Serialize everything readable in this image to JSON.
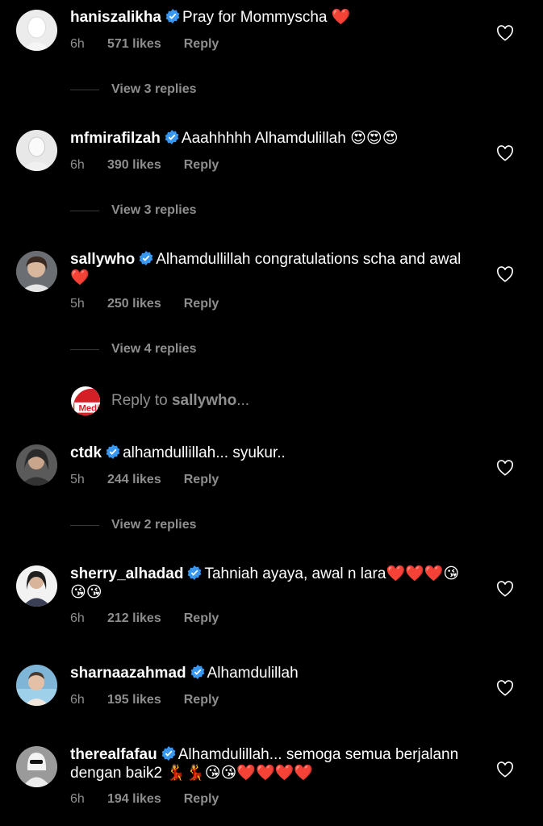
{
  "comments": [
    {
      "username": "haniszalikha",
      "text": "Pray for Mommyscha ❤️",
      "time": "6h",
      "likes": "571 likes",
      "reply": "Reply",
      "view_replies": "View 3 replies"
    },
    {
      "username": "mfmirafilzah",
      "text": "Aaahhhhh Alhamdulillah 😍😍😍",
      "time": "6h",
      "likes": "390 likes",
      "reply": "Reply",
      "view_replies": "View 3 replies"
    },
    {
      "username": "sallywho",
      "text": "Alhamdullillah congratulations scha and awal ❤️",
      "time": "5h",
      "likes": "250 likes",
      "reply": "Reply",
      "view_replies": "View 4 replies"
    },
    {
      "username": "ctdk",
      "text": "alhamdullillah... syukur..",
      "time": "5h",
      "likes": "244 likes",
      "reply": "Reply",
      "view_replies": "View 2 replies"
    },
    {
      "username": "sherry_alhadad",
      "text": "Tahniah ayaya, awal n lara❤️❤️❤️😘😘😘",
      "time": "6h",
      "likes": "212 likes",
      "reply": "Reply"
    },
    {
      "username": "sharnaazahmad",
      "text": "Alhamdulillah",
      "time": "6h",
      "likes": "195 likes",
      "reply": "Reply"
    },
    {
      "username": "therealfafau",
      "text": "Alhamdulillah... semoga semua berjalann dengan baik2 💃💃😘😘❤️❤️❤️❤️",
      "time": "6h",
      "likes": "194 likes",
      "reply": "Reply"
    }
  ],
  "composer": {
    "prefix": "Reply to ",
    "target": "sallywho",
    "suffix": "...",
    "avatar_text": "Media"
  },
  "colors": {
    "background": "#000000",
    "muted": "#8e8e8e",
    "verified": "#3897f0",
    "heart": "#ed4956"
  },
  "icons": {
    "verified": "verified-badge-icon",
    "like": "heart-outline-icon"
  }
}
